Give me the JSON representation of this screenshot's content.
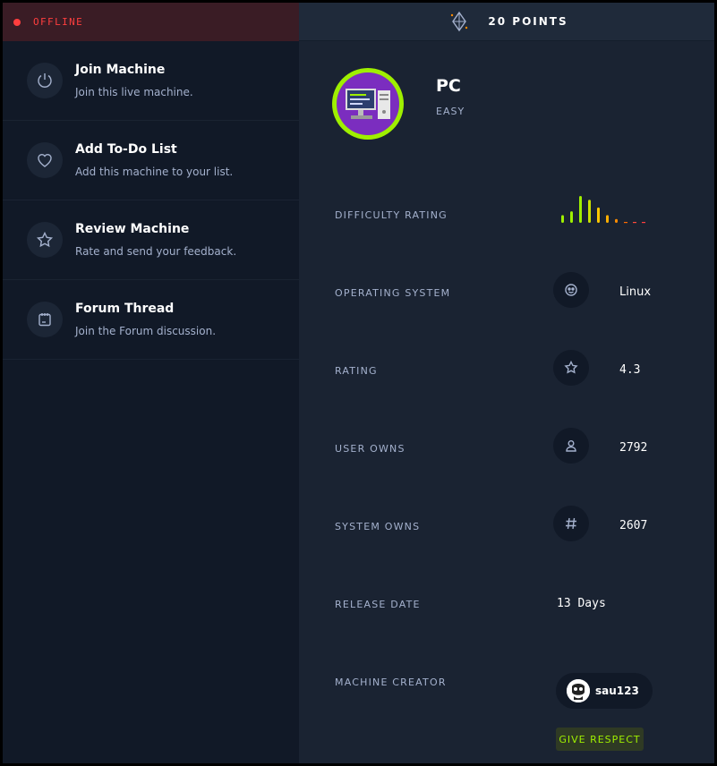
{
  "status": {
    "label": "OFFLINE",
    "color": "#ff3e3e"
  },
  "points": {
    "label": "20 POINTS"
  },
  "actions": [
    {
      "title": "Join Machine",
      "subtitle": "Join this live machine.",
      "icon": "power-icon"
    },
    {
      "title": "Add To-Do List",
      "subtitle": "Add this machine to your list.",
      "icon": "heart-icon"
    },
    {
      "title": "Review Machine",
      "subtitle": "Rate and send your feedback.",
      "icon": "star-icon"
    },
    {
      "title": "Forum Thread",
      "subtitle": "Join the Forum discussion.",
      "icon": "forum-icon"
    }
  ],
  "machine": {
    "name": "PC",
    "difficulty": "EASY"
  },
  "details": {
    "difficulty_label": "DIFFICULTY RATING",
    "difficulty_bars": [
      2,
      3,
      7,
      6,
      4,
      2,
      1,
      0,
      0,
      0
    ],
    "os_label": "OPERATING SYSTEM",
    "os_value": "Linux",
    "rating_label": "RATING",
    "rating_value": "4.3",
    "user_owns_label": "USER OWNS",
    "user_owns_value": "2792",
    "system_owns_label": "SYSTEM OWNS",
    "system_owns_value": "2607",
    "release_label": "RELEASE DATE",
    "release_value": "13 Days",
    "creator_label": "MACHINE CREATOR",
    "creator_name": "sau123",
    "respect_label": "GIVE RESPECT"
  },
  "colors": {
    "accent": "#9fef00",
    "panel_left": "#111927",
    "panel_right": "#1a2332"
  }
}
